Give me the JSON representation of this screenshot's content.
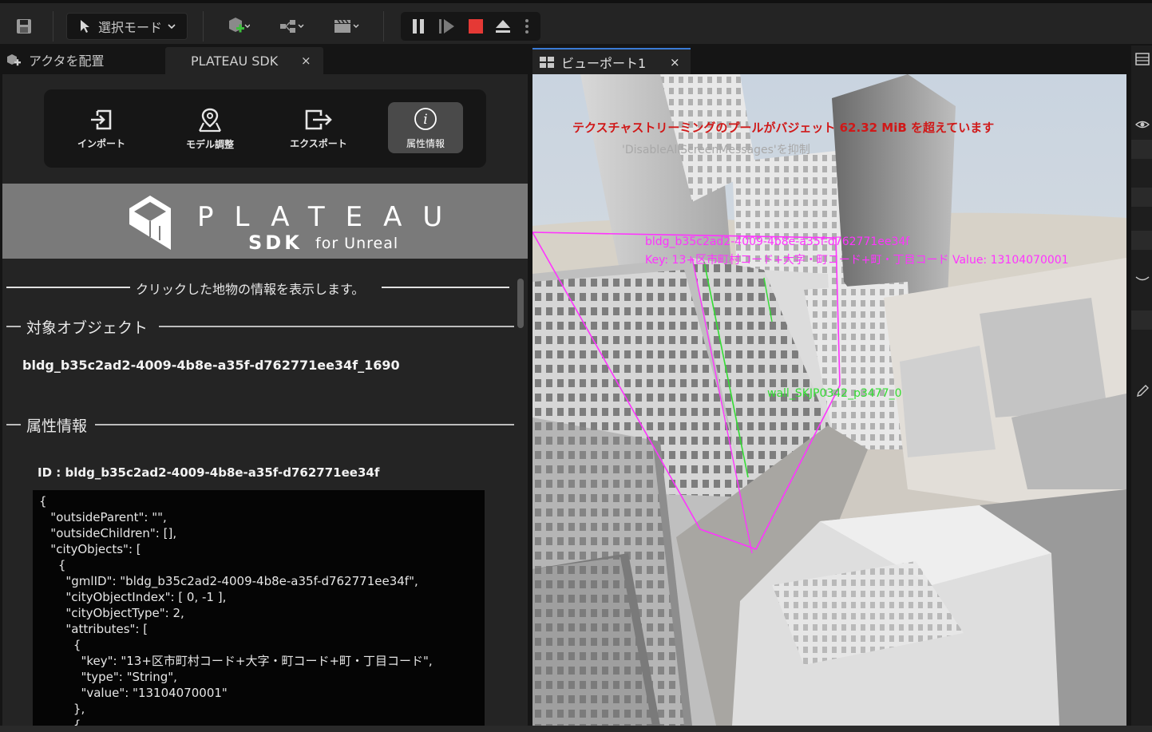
{
  "toolbar": {
    "mode_label": "選択モード"
  },
  "left_tabs": {
    "place_actors": "アクタを配置",
    "plateau_sdk": "PLATEAU SDK",
    "close": "×"
  },
  "mode_bar": {
    "import": "インポート",
    "model_adjust": "モデル調整",
    "export": "エクスポート",
    "attributes": "属性情報"
  },
  "banner": {
    "brand": "PLATEAU",
    "sdk": "SDK",
    "for_unreal": "for Unreal"
  },
  "panel": {
    "hint": "クリックした地物の情報を表示します。",
    "target_section": "対象オブジェクト",
    "target_object": "bldg_b35c2ad2-4009-4b8e-a35f-d762771ee34f_1690",
    "attr_section": "属性情報",
    "id_label": "ID : bldg_b35c2ad2-4009-4b8e-a35f-d762771ee34f",
    "json_text": "{\n   \"outsideParent\": \"\",\n   \"outsideChildren\": [],\n   \"cityObjects\": [\n     {\n       \"gmlID\": \"bldg_b35c2ad2-4009-4b8e-a35f-d762771ee34f\",\n       \"cityObjectIndex\": [ 0, -1 ],\n       \"cityObjectType\": 2,\n       \"attributes\": [\n         {\n           \"key\": \"13+区市町村コード+大字・町コード+町・丁目コード\",\n           \"type\": \"String\",\n           \"value\": \"13104070001\"\n         },\n         {"
  },
  "viewport": {
    "tab_label": "ビューポート1",
    "close": "×",
    "warning": "テクスチャストリーミングのプールがバジェット 62.32 MiB を超えています",
    "suppress_msg": "'DisableAllScreenMessages'を抑制",
    "bldg_label": "bldg_b35c2ad2-4009-4b8e-a35f-d762771ee34f",
    "key_label": "Key: 13+区市町村コード+大字・町コード+町・丁目コード Value: 13104070001",
    "wall_label": "wall_SKJP0342_p3477_0"
  },
  "colors": {
    "accent": "#3a7bd5",
    "warning": "#d01818",
    "magenta": "#ff33ff",
    "green": "#33dd33",
    "stop": "#e53935"
  }
}
